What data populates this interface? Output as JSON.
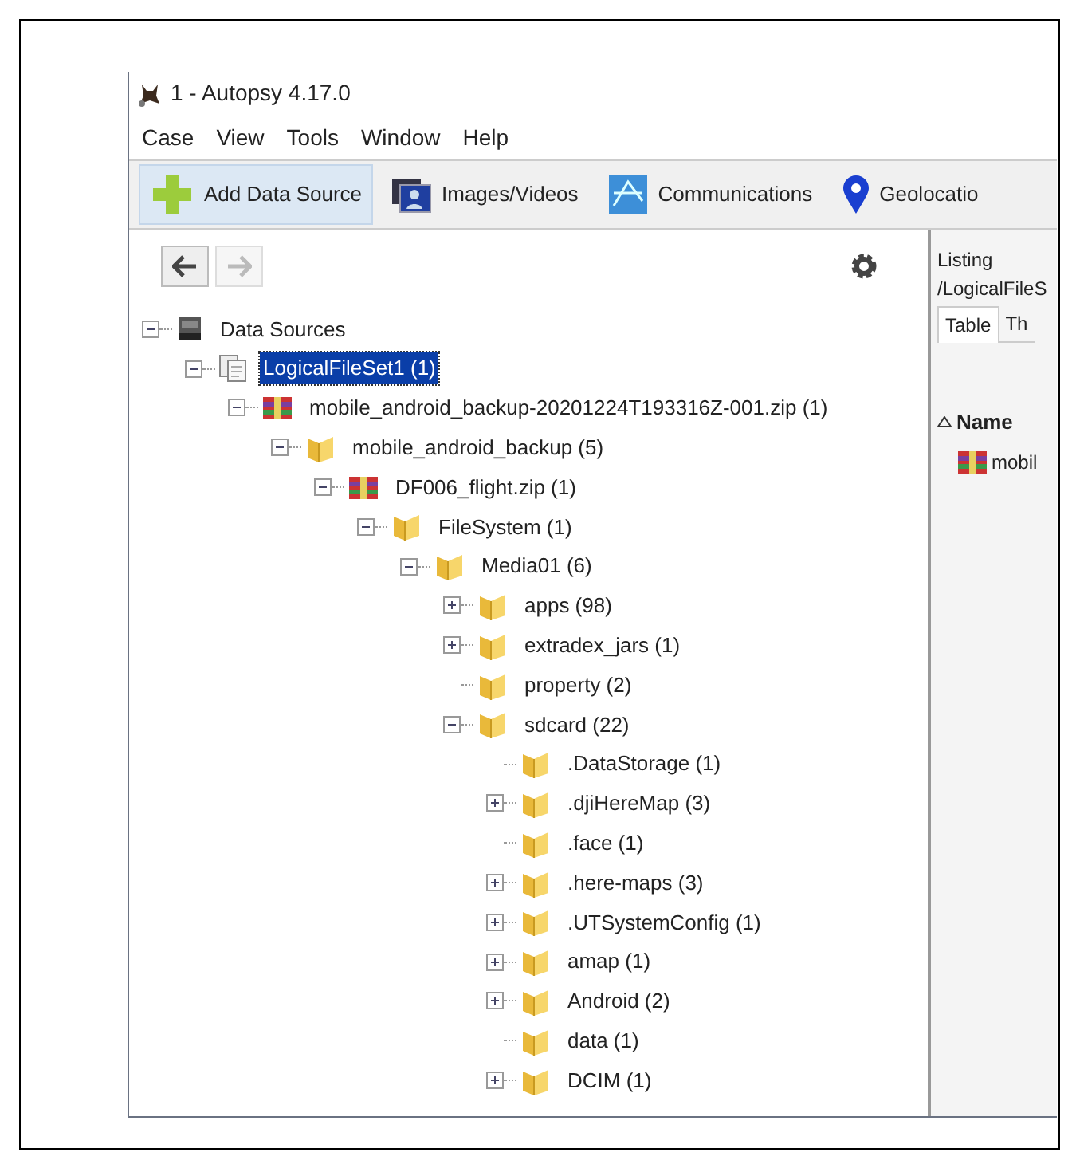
{
  "window": {
    "title": "1 - Autopsy 4.17.0"
  },
  "menu": [
    "Case",
    "View",
    "Tools",
    "Window",
    "Help"
  ],
  "toolbar": [
    {
      "label": "Add Data Source",
      "kind": "add",
      "selected": true
    },
    {
      "label": "Images/Videos",
      "kind": "images",
      "selected": false
    },
    {
      "label": "Communications",
      "kind": "communications",
      "selected": false
    },
    {
      "label": "Geolocatio",
      "kind": "geolocation",
      "selected": false
    }
  ],
  "navigation": {
    "back": {
      "disabled": false
    },
    "forward": {
      "disabled": true
    }
  },
  "tree": [
    {
      "label": "Data Sources",
      "kind": "drive",
      "expanded": true,
      "selected": false,
      "children": [
        {
          "label": "LogicalFileSet1 (1)",
          "kind": "files",
          "expanded": true,
          "selected": true,
          "children": [
            {
              "label": "mobile_android_backup-20201224T193316Z-001.zip (1)",
              "kind": "archive",
              "expanded": true,
              "selected": false,
              "children": [
                {
                  "label": "mobile_android_backup (5)",
                  "kind": "folder",
                  "expanded": true,
                  "selected": false,
                  "children": [
                    {
                      "label": "DF006_flight.zip (1)",
                      "kind": "archive",
                      "expanded": true,
                      "selected": false,
                      "children": [
                        {
                          "label": "FileSystem (1)",
                          "kind": "folder",
                          "expanded": true,
                          "selected": false,
                          "children": [
                            {
                              "label": "Media01 (6)",
                              "kind": "folder",
                              "expanded": true,
                              "selected": false,
                              "children": [
                                {
                                  "label": "apps (98)",
                                  "kind": "folder",
                                  "expanded": false,
                                  "selected": false
                                },
                                {
                                  "label": "extradex_jars (1)",
                                  "kind": "folder",
                                  "expanded": false,
                                  "selected": false
                                },
                                {
                                  "label": "property (2)",
                                  "kind": "folder",
                                  "selected": false
                                },
                                {
                                  "label": "sdcard (22)",
                                  "kind": "folder",
                                  "expanded": true,
                                  "selected": false,
                                  "children": [
                                    {
                                      "label": ".DataStorage (1)",
                                      "kind": "folder",
                                      "selected": false
                                    },
                                    {
                                      "label": ".djiHereMap (3)",
                                      "kind": "folder",
                                      "expanded": false,
                                      "selected": false
                                    },
                                    {
                                      "label": ".face (1)",
                                      "kind": "folder",
                                      "selected": false
                                    },
                                    {
                                      "label": ".here-maps (3)",
                                      "kind": "folder",
                                      "expanded": false,
                                      "selected": false
                                    },
                                    {
                                      "label": ".UTSystemConfig (1)",
                                      "kind": "folder",
                                      "expanded": false,
                                      "selected": false
                                    },
                                    {
                                      "label": "amap (1)",
                                      "kind": "folder",
                                      "expanded": false,
                                      "selected": false
                                    },
                                    {
                                      "label": "Android (2)",
                                      "kind": "folder",
                                      "expanded": false,
                                      "selected": false
                                    },
                                    {
                                      "label": "data (1)",
                                      "kind": "folder",
                                      "selected": false
                                    },
                                    {
                                      "label": "DCIM (1)",
                                      "kind": "folder",
                                      "expanded": false,
                                      "selected": false
                                    }
                                  ]
                                }
                              ]
                            }
                          ]
                        }
                      ]
                    }
                  ]
                }
              ]
            }
          ]
        }
      ]
    }
  ],
  "listing": {
    "title": "Listing",
    "path": "/LogicalFileS",
    "tabs": [
      {
        "label": "Table",
        "selected": true
      },
      {
        "label": "Th",
        "selected": false
      }
    ],
    "columns": [
      {
        "label": "Name",
        "sort_ascending": true
      }
    ],
    "rows": [
      {
        "name": "mobil",
        "kind": "archive"
      }
    ]
  }
}
